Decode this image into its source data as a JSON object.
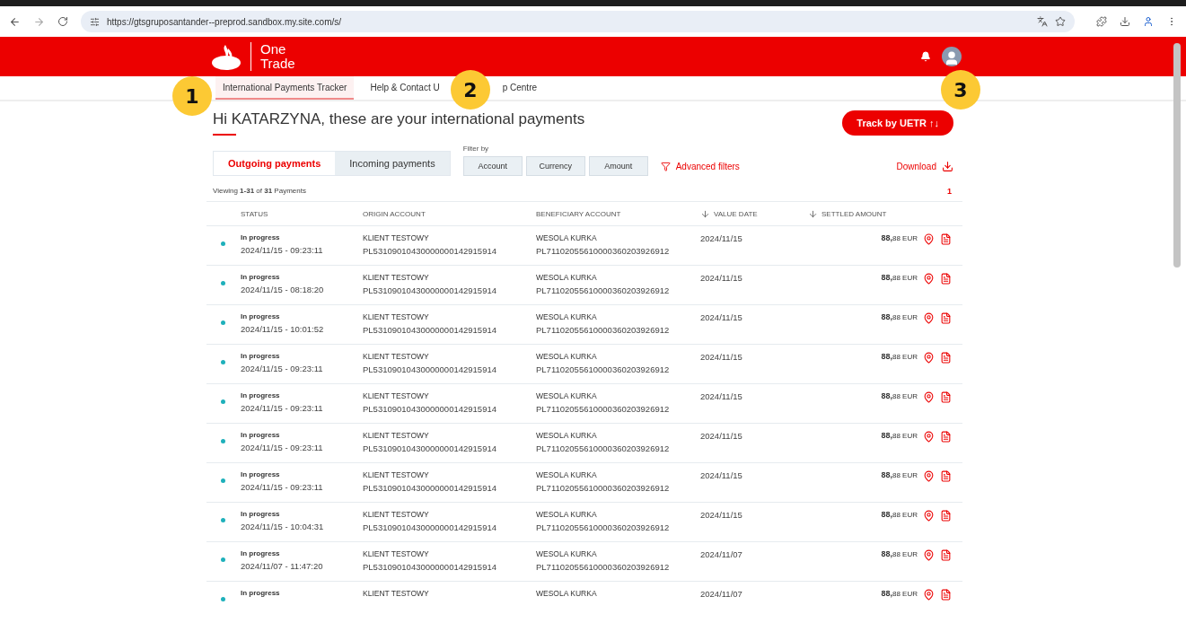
{
  "browser": {
    "url": "https://gtsgruposantander--preprod.sandbox.my.site.com/s/"
  },
  "header": {
    "brand_line1": "One",
    "brand_line2": "Trade"
  },
  "nav": [
    {
      "label": "International Payments Tracker",
      "selected": true
    },
    {
      "label": "Help & Contact U",
      "selected": false
    },
    {
      "label": "p Centre",
      "selected": false
    }
  ],
  "annotations": [
    "1",
    "2",
    "3"
  ],
  "page": {
    "greeting": "Hi KATARZYNA, these are your international payments",
    "track_button": "Track by UETR ↑↓",
    "tabs": [
      {
        "label": "Outgoing payments",
        "selected": true
      },
      {
        "label": "Incoming payments",
        "selected": false
      }
    ],
    "filter_label": "Filter by",
    "filters": [
      "Account",
      "Currency",
      "Amount"
    ],
    "advanced_filters": "Advanced filters",
    "download": "Download",
    "viewing": "Viewing **1-31** of **31** Payments",
    "page_number": "1"
  },
  "table": {
    "columns": [
      {
        "label": "STATUS",
        "sortable": false
      },
      {
        "label": "ORIGIN ACCOUNT",
        "sortable": false
      },
      {
        "label": "BENEFICIARY ACCOUNT",
        "sortable": false
      },
      {
        "label": "VALUE DATE",
        "sortable": true
      },
      {
        "label": "SETTLED AMOUNT",
        "sortable": true
      }
    ],
    "rows": [
      {
        "status": "In progress",
        "timestamp": "2024/11/15 - 09:23:11",
        "origin_name": "KLIENT TESTOWY",
        "origin_account": "PL53109010430000000142915914",
        "beneficiary_name": "WESOLA KURKA",
        "beneficiary_account": "PL71102055610000360203926912",
        "value_date": "2024/11/15",
        "amount": "**88,**88 EUR"
      },
      {
        "status": "In progress",
        "timestamp": "2024/11/15 - 08:18:20",
        "origin_name": "KLIENT TESTOWY",
        "origin_account": "PL53109010430000000142915914",
        "beneficiary_name": "WESOLA KURKA",
        "beneficiary_account": "PL71102055610000360203926912",
        "value_date": "2024/11/15",
        "amount": "**88,**88 EUR"
      },
      {
        "status": "In progress",
        "timestamp": "2024/11/15 - 10:01:52",
        "origin_name": "KLIENT TESTOWY",
        "origin_account": "PL53109010430000000142915914",
        "beneficiary_name": "WESOLA KURKA",
        "beneficiary_account": "PL71102055610000360203926912",
        "value_date": "2024/11/15",
        "amount": "**88,**88 EUR"
      },
      {
        "status": "In progress",
        "timestamp": "2024/11/15 - 09:23:11",
        "origin_name": "KLIENT TESTOWY",
        "origin_account": "PL53109010430000000142915914",
        "beneficiary_name": "WESOLA KURKA",
        "beneficiary_account": "PL71102055610000360203926912",
        "value_date": "2024/11/15",
        "amount": "**88,**88 EUR"
      },
      {
        "status": "In progress",
        "timestamp": "2024/11/15 - 09:23:11",
        "origin_name": "KLIENT TESTOWY",
        "origin_account": "PL53109010430000000142915914",
        "beneficiary_name": "WESOLA KURKA",
        "beneficiary_account": "PL71102055610000360203926912",
        "value_date": "2024/11/15",
        "amount": "**88,**88 EUR"
      },
      {
        "status": "In progress",
        "timestamp": "2024/11/15 - 09:23:11",
        "origin_name": "KLIENT TESTOWY",
        "origin_account": "PL53109010430000000142915914",
        "beneficiary_name": "WESOLA KURKA",
        "beneficiary_account": "PL71102055610000360203926912",
        "value_date": "2024/11/15",
        "amount": "**88,**88 EUR"
      },
      {
        "status": "In progress",
        "timestamp": "2024/11/15 - 09:23:11",
        "origin_name": "KLIENT TESTOWY",
        "origin_account": "PL53109010430000000142915914",
        "beneficiary_name": "WESOLA KURKA",
        "beneficiary_account": "PL71102055610000360203926912",
        "value_date": "2024/11/15",
        "amount": "**88,**88 EUR"
      },
      {
        "status": "In progress",
        "timestamp": "2024/11/15 - 10:04:31",
        "origin_name": "KLIENT TESTOWY",
        "origin_account": "PL53109010430000000142915914",
        "beneficiary_name": "WESOLA KURKA",
        "beneficiary_account": "PL71102055610000360203926912",
        "value_date": "2024/11/15",
        "amount": "**88,**88 EUR"
      },
      {
        "status": "In progress",
        "timestamp": "2024/11/07 - 11:47:20",
        "origin_name": "KLIENT TESTOWY",
        "origin_account": "PL53109010430000000142915914",
        "beneficiary_name": "WESOLA KURKA",
        "beneficiary_account": "PL71102055610000360203926912",
        "value_date": "2024/11/07",
        "amount": "**88,**88 EUR"
      },
      {
        "status": "In progress",
        "origin_name": "KLIENT TESTOWY",
        "beneficiary_name": "WESOLA KURKA",
        "value_date": "2024/11/07",
        "amount": "**88,**88 EUR"
      }
    ]
  }
}
